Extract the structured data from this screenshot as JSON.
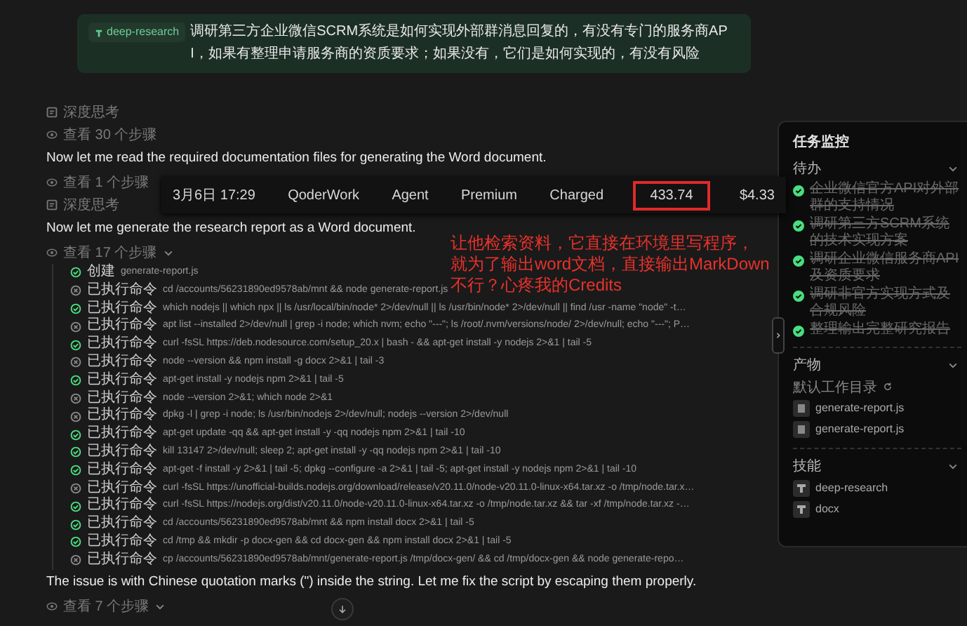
{
  "prompt": {
    "skill": "deep-research",
    "text": "调研第三方企业微信SCRM系统是如何实现外部群消息回复的，有没有专门的服务商API，如果有整理申请服务商的资质要求；如果没有，它们是如何实现的，有没有风险"
  },
  "feed": [
    {
      "kind": "thinking",
      "text": "深度思考"
    },
    {
      "kind": "steps",
      "text": "查看 30 个步骤",
      "toggle": false
    },
    {
      "kind": "message",
      "text": "Now let me read the required documentation files for generating the Word document."
    },
    {
      "kind": "steps",
      "text": "查看 1 个步骤",
      "toggle": false
    },
    {
      "kind": "thinking",
      "text": "深度思考"
    },
    {
      "kind": "message",
      "text": "Now let me generate the research report as a Word document."
    },
    {
      "kind": "steps",
      "text": "查看 17 个步骤",
      "toggle": true
    },
    {
      "kind": "log",
      "items": [
        {
          "action": "创建",
          "command": "generate-report.js",
          "ok": true
        },
        {
          "action": "已执行命令",
          "command": "cd /accounts/56231890ed9578ab/mnt && node generate-report.js",
          "ok": false
        },
        {
          "action": "已执行命令",
          "command": "which nodejs || which npx || ls /usr/local/bin/node* 2>/dev/null || ls /usr/bin/node* 2>/dev/null || find /usr -name \"node\" -t…",
          "ok": true
        },
        {
          "action": "已执行命令",
          "command": "apt list --installed 2>/dev/null | grep -i node; which nvm; echo \"---\"; ls /root/.nvm/versions/node/ 2>/dev/null; echo \"---\"; P…",
          "ok": false
        },
        {
          "action": "已执行命令",
          "command": "curl -fsSL https://deb.nodesource.com/setup_20.x | bash - && apt-get install -y nodejs 2>&1 | tail -5",
          "ok": true
        },
        {
          "action": "已执行命令",
          "command": "node --version && npm install -g docx 2>&1 | tail -3",
          "ok": false
        },
        {
          "action": "已执行命令",
          "command": "apt-get install -y nodejs npm 2>&1 | tail -5",
          "ok": true
        },
        {
          "action": "已执行命令",
          "command": "node --version 2>&1; which node 2>&1",
          "ok": false
        },
        {
          "action": "已执行命令",
          "command": "dpkg -l | grep -i node; ls /usr/bin/nodejs 2>/dev/null; nodejs --version 2>/dev/null",
          "ok": false
        },
        {
          "action": "已执行命令",
          "command": "apt-get update -qq && apt-get install -y -qq nodejs npm 2>&1 | tail -10",
          "ok": true
        },
        {
          "action": "已执行命令",
          "command": "kill 13147 2>/dev/null; sleep 2; apt-get install -y -qq nodejs npm 2>&1 | tail -10",
          "ok": true
        },
        {
          "action": "已执行命令",
          "command": "apt-get -f install -y 2>&1 | tail -5; dpkg --configure -a 2>&1 | tail -5; apt-get install -y nodejs npm 2>&1 | tail -10",
          "ok": true
        },
        {
          "action": "已执行命令",
          "command": "curl -fsSL https://unofficial-builds.nodejs.org/download/release/v20.11.0/node-v20.11.0-linux-x64.tar.xz -o /tmp/node.tar.x…",
          "ok": false
        },
        {
          "action": "已执行命令",
          "command": "curl -fsSL https://nodejs.org/dist/v20.11.0/node-v20.11.0-linux-x64.tar.xz -o /tmp/node.tar.xz && tar -xf /tmp/node.tar.xz -…",
          "ok": true
        },
        {
          "action": "已执行命令",
          "command": "cd /accounts/56231890ed9578ab/mnt && npm install docx 2>&1 | tail -5",
          "ok": true
        },
        {
          "action": "已执行命令",
          "command": "cd /tmp && mkdir -p docx-gen && cd docx-gen && npm install docx 2>&1 | tail -5",
          "ok": true
        },
        {
          "action": "已执行命令",
          "command": "cp /accounts/56231890ed9578ab/mnt/generate-report.js /tmp/docx-gen/ && cd /tmp/docx-gen && node generate-repo…",
          "ok": false
        }
      ]
    },
    {
      "kind": "message",
      "text": "The issue is with Chinese quotation marks (\") inside the string. Let me fix the script by escaping them properly."
    },
    {
      "kind": "steps",
      "text": "查看 7 个步骤",
      "toggle": true
    }
  ],
  "usage": [
    {
      "text": "3月6日 17:29",
      "highlighted": false
    },
    {
      "text": "QoderWork",
      "highlighted": false
    },
    {
      "text": "Agent",
      "highlighted": false
    },
    {
      "text": "Premium",
      "highlighted": false
    },
    {
      "text": "Charged",
      "highlighted": false
    },
    {
      "text": "433.74",
      "highlighted": true
    },
    {
      "text": "$4.33",
      "highlighted": false
    }
  ],
  "annotation": [
    "让他检索资料，它直接在环境里写程序，",
    "就为了输出word文档，直接输出MarkDown",
    "不行？心疼我的Credits"
  ],
  "panel": {
    "title": "任务监控",
    "todo": {
      "title": "待办",
      "items": [
        {
          "text": "企业微信官方API对外部群的支持情况",
          "done": true
        },
        {
          "text": "调研第三方SCRM系统的技术实现方案",
          "done": true
        },
        {
          "text": "调研企业微信服务商API及资质要求",
          "done": true
        },
        {
          "text": "调研非官方实现方式及合规风险",
          "done": true
        },
        {
          "text": "整理输出完整研究报告",
          "done": true
        }
      ]
    },
    "artifacts": {
      "title": "产物",
      "folder": "默认工作目录",
      "files": [
        "generate-report.js",
        "generate-report.js"
      ]
    },
    "skills": {
      "title": "技能",
      "items": [
        "deep-research",
        "docx"
      ]
    }
  }
}
